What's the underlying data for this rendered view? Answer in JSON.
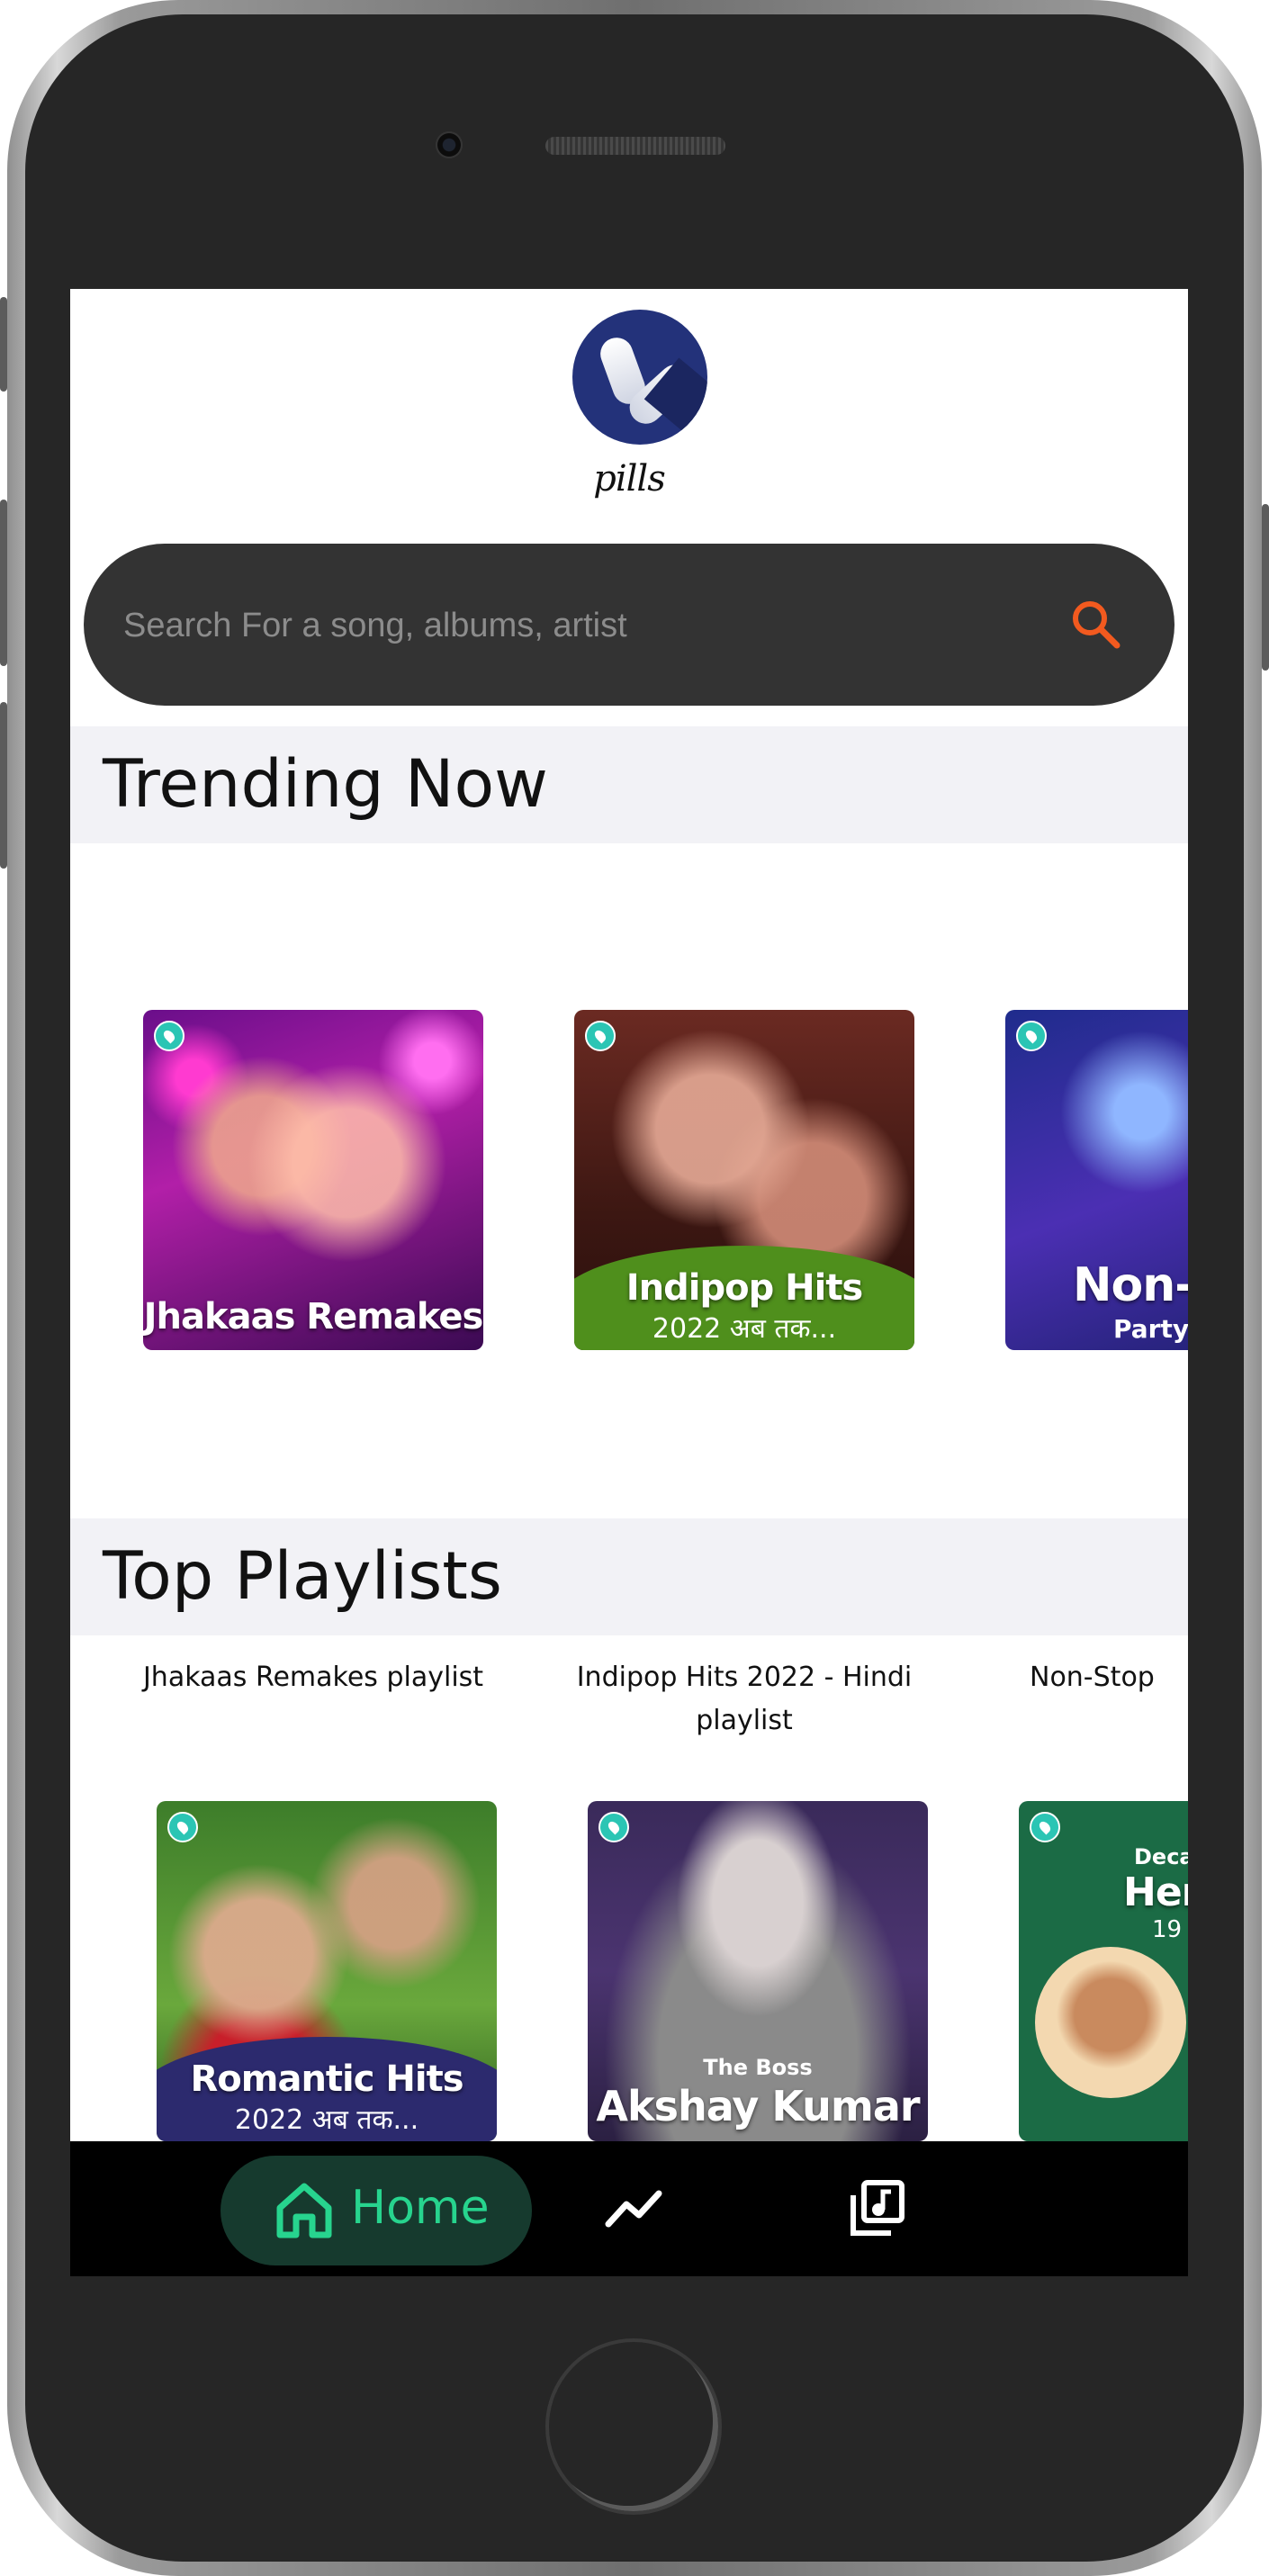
{
  "app": {
    "brand": "pills"
  },
  "search": {
    "placeholder": "Search For a song, albums, artist"
  },
  "sections": {
    "trending": {
      "title": "Trending Now",
      "items": [
        {
          "cover_title": "Jhakaas Remakes",
          "cover_sub": "",
          "caption": "Jhakaas Remakes playlist"
        },
        {
          "cover_title": "Indipop Hits",
          "cover_sub": "2022 अब तक...",
          "caption": "Indipop Hits 2022 - Hindi playlist"
        },
        {
          "cover_title": "Non-",
          "cover_sub": "Party",
          "caption": "Non-Stop"
        }
      ]
    },
    "top_playlists": {
      "title": "Top Playlists",
      "items": [
        {
          "cover_title": "Romantic Hits",
          "cover_sub": "2022 अब तक..."
        },
        {
          "cover_kicker": "The Boss",
          "cover_title": "Akshay Kumar"
        },
        {
          "cover_kicker": "Deca",
          "cover_title": "Her",
          "cover_sub": "19"
        }
      ]
    }
  },
  "nav": {
    "home_label": "Home"
  },
  "colors": {
    "accent_green": "#27d48e",
    "search_icon": "#f25a1f",
    "search_bg": "#333333",
    "section_header_bg": "#f2f2f6",
    "brand_navy": "#23327a"
  }
}
